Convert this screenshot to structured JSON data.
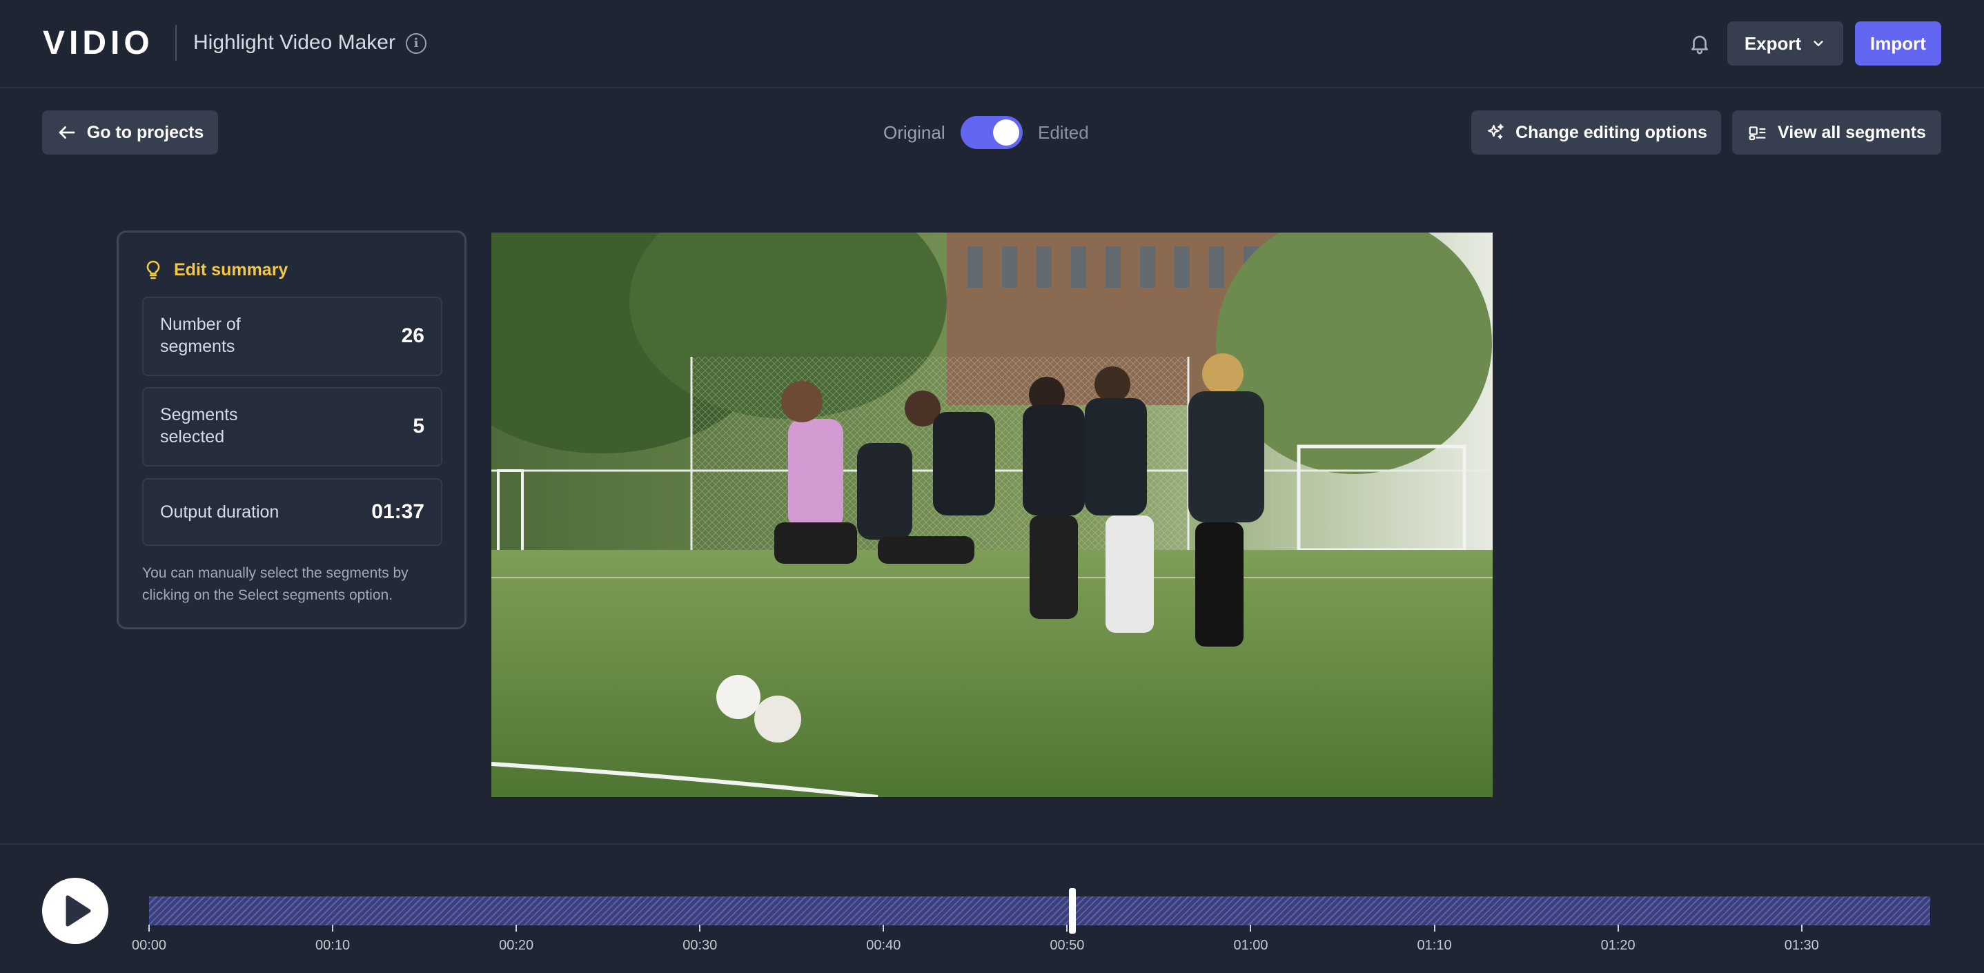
{
  "header": {
    "logo": "VIDIO",
    "app_title": "Highlight Video Maker",
    "export_label": "Export",
    "import_label": "Import"
  },
  "toolbar": {
    "back_label": "Go to projects",
    "toggle_original": "Original",
    "toggle_edited": "Edited",
    "toggle_state": "Edited",
    "change_options_label": "Change editing options",
    "view_segments_label": "View all segments"
  },
  "summary": {
    "title": "Edit summary",
    "stats": [
      {
        "label": "Number of segments",
        "value": "26"
      },
      {
        "label": "Segments selected",
        "value": "5"
      },
      {
        "label": "Output duration",
        "value": "01:37"
      }
    ],
    "note": "You can manually select the segments by clicking on the Select segments option."
  },
  "timeline": {
    "ticks": [
      "00:00",
      "00:10",
      "00:20",
      "00:30",
      "00:40",
      "00:50",
      "01:00",
      "01:10",
      "01:20",
      "01:30"
    ],
    "playhead_time_seconds": 50.3,
    "total_duration_seconds": 97
  },
  "colors": {
    "accent": "#6366f1",
    "highlight": "#f5c842",
    "background": "#1f2533"
  },
  "icons": {
    "info": "info-circle-icon",
    "bell": "bell-icon",
    "chevron": "chevron-down-icon",
    "back": "arrow-left-icon",
    "sparkle": "sparkle-icon",
    "segments": "segments-icon",
    "bulb": "lightbulb-icon",
    "play": "play-icon"
  }
}
